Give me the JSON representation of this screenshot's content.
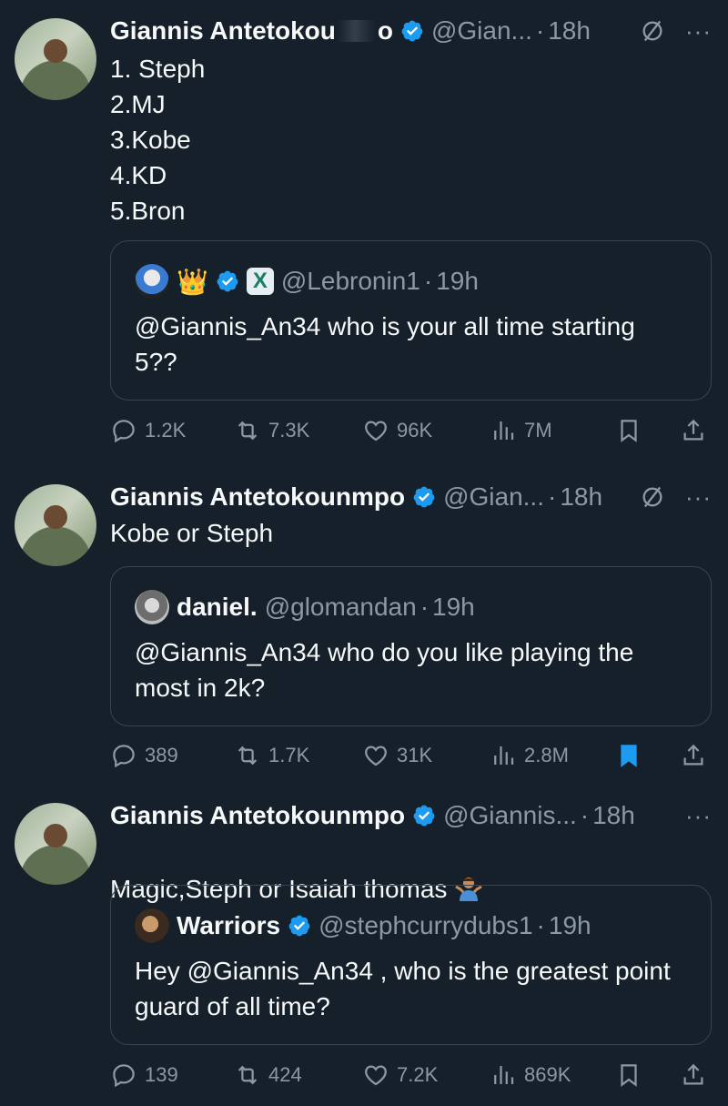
{
  "tweets": [
    {
      "name": "Giannis Antetokou",
      "name_tail": "o",
      "handle": "@Gian...",
      "time": "18h",
      "text": "1. Steph\n2.MJ\n3.Kobe\n4.KD\n5.Bron",
      "quote": {
        "crown": "👑",
        "x_badge": "X",
        "handle": "@Lebronin1",
        "time": "19h",
        "text": "@Giannis_An34 who is your all time starting 5??"
      },
      "stats": {
        "replies": "1.2K",
        "reposts": "7.3K",
        "likes": "96K",
        "views": "7M"
      },
      "bookmarked": false
    },
    {
      "name": "Giannis Antetokounmpo",
      "handle": "@Gian...",
      "time": "18h",
      "text": "Kobe or Steph",
      "quote": {
        "name": "daniel.",
        "handle": "@glomandan",
        "time": "19h",
        "text": "@Giannis_An34 who do you like playing the most in 2k?"
      },
      "stats": {
        "replies": "389",
        "reposts": "1.7K",
        "likes": "31K",
        "views": "2.8M"
      },
      "bookmarked": true
    },
    {
      "name": "Giannis Antetokounmpo",
      "handle": "@Giannis...",
      "time": "18h",
      "text": "Magic,Steph or Isaiah thomas",
      "quote": {
        "name": "Warriors",
        "handle": "@stephcurrydubs1",
        "time": "19h",
        "text": "Hey @Giannis_An34 , who is the greatest point guard of all time?"
      },
      "stats": {
        "replies": "139",
        "reposts": "424",
        "likes": "7.2K",
        "views": "869K"
      },
      "bookmarked": false
    }
  ],
  "ui": {
    "dot": "·",
    "more": "···"
  },
  "colors": {
    "background": "#15202b",
    "text": "#f7f9f9",
    "muted": "#8b98a5",
    "border": "#38444d",
    "accent": "#1d9bf0"
  },
  "icons": [
    "verified-badge-icon",
    "grok-icon",
    "more-icon",
    "reply-icon",
    "repost-icon",
    "like-icon",
    "views-icon",
    "bookmark-icon",
    "share-icon"
  ]
}
